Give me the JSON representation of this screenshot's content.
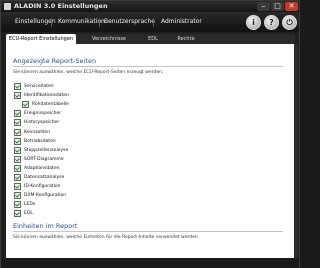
{
  "window": {
    "title": "ALADIN  3.0  Einstellungen"
  },
  "menu": {
    "items": [
      "Einstellungen",
      "Kommunikation",
      "Benutzersprache",
      "Administrator"
    ]
  },
  "toolbar": {
    "info_label": "i",
    "help_label": "?",
    "close_label": "⏻"
  },
  "tabs": [
    "ECU-Report Einstellungen",
    "Verzeichnisse",
    "EDL",
    "Rechte"
  ],
  "section1": {
    "title": "Angezeigte Report-Seiten",
    "description": "Sie können auswählen, welche ECU-Report-Seiten  erzeugt werden.",
    "items": [
      "Servicedaten",
      "Identifikationsdaten",
      "Rohdatentabelle",
      "Ereignisspeicher",
      "Historyspeicher",
      "Kennzahlen",
      "Betriebsdaten",
      "Stoppzeitenanalyse",
      "SORT-Diagramme",
      "Adaptionsdaten",
      "Datensatzanalyse",
      "ID-Konfiguration",
      "DXM-Konfiguration",
      "LEDs",
      "EOL"
    ]
  },
  "section2": {
    "title": "Einheiten im Report",
    "description": "Sie können auswählen, welche Einheiten für die Report-Inhalte verwendet werden."
  },
  "colors": {
    "accent": "#1e4f9c",
    "check": "#1c8a1c",
    "chrome": "#202020"
  }
}
